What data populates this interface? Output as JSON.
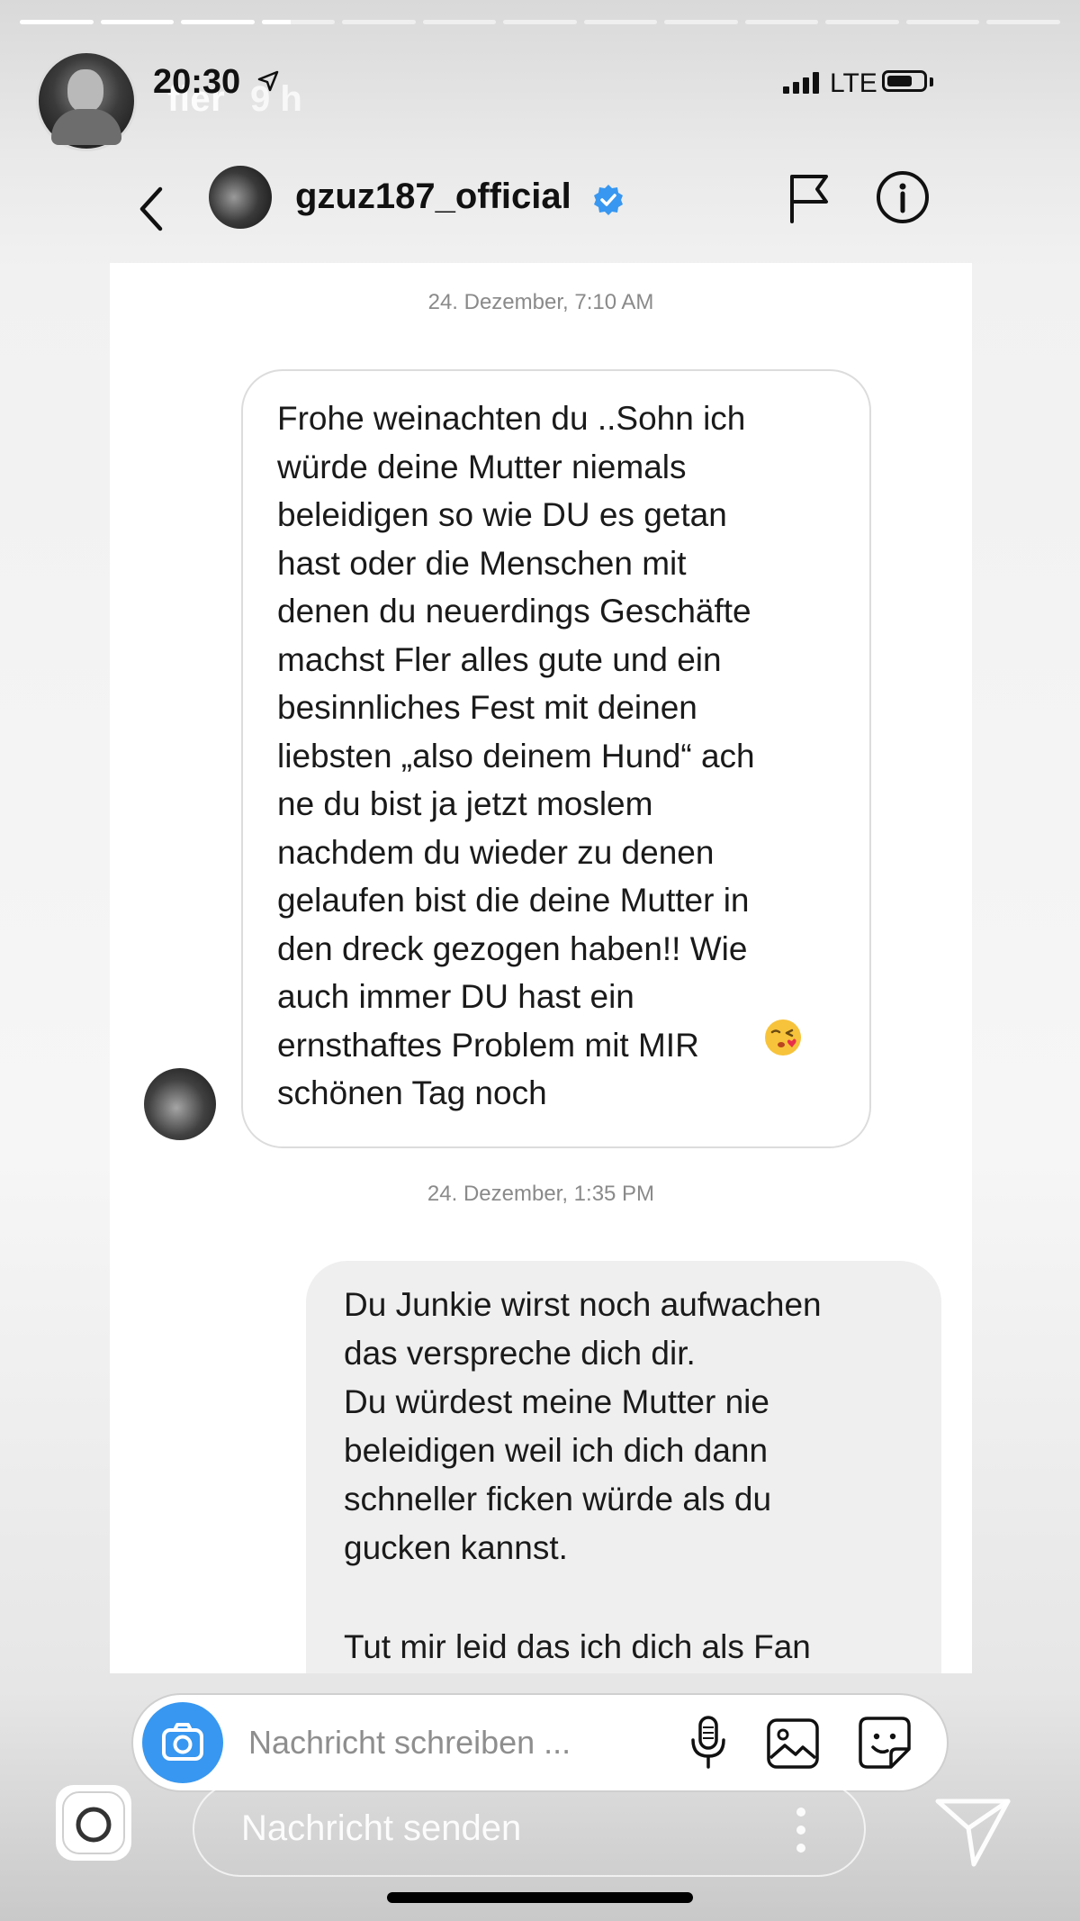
{
  "story": {
    "username": "fler",
    "age": "9 h",
    "segments": [
      1,
      1,
      1,
      0.4,
      0,
      0,
      0,
      0,
      0,
      0,
      0,
      0,
      0
    ]
  },
  "status_bar": {
    "time": "20:30",
    "network": "LTE",
    "battery_level": 0.7
  },
  "dm": {
    "username": "gzuz187_official",
    "verified": true,
    "accent_color": "#3897f0"
  },
  "chat": {
    "timestamp_1": "24. Dezember, 7:10 AM",
    "message_in": "Frohe weinachten du ..Sohn ich\nwürde deine Mutter niemals\nbeleidigen so wie DU es getan\nhast oder die Menschen mit\ndenen du neuerdings Geschäfte\nmachst Fler alles gute und ein\nbesinnliches Fest mit deinen\nliebsten „also deinem  Hund“ ach\nne du bist ja jetzt moslem\nnachdem du wieder zu denen\ngelaufen bist die deine Mutter in\nden dreck gezogen haben!! Wie\nauch immer DU hast ein\nernsthaftes Problem mit MIR",
    "message_in_end": "schönen Tag noch",
    "emoji": "face-throwing-kiss",
    "timestamp_2": "24. Dezember, 1:35 PM",
    "message_out_1": "Du Junkie wirst noch aufwachen\ndas verspreche dich dir.\nDu würdest meine Mutter nie\nbeleidigen weil ich dich dann\nschneller ficken würde als du\ngucken kannst.",
    "message_out_2": "Tut mir leid das ich dich als Fan"
  },
  "composer": {
    "placeholder": "Nachricht schreiben ..."
  },
  "story_footer": {
    "placeholder": "Nachricht senden"
  },
  "icons": [
    "back-icon",
    "verified-icon",
    "flag-icon",
    "info-icon",
    "camera-icon",
    "microphone-icon",
    "gallery-icon",
    "sticker-icon",
    "send-icon",
    "more-icon"
  ]
}
